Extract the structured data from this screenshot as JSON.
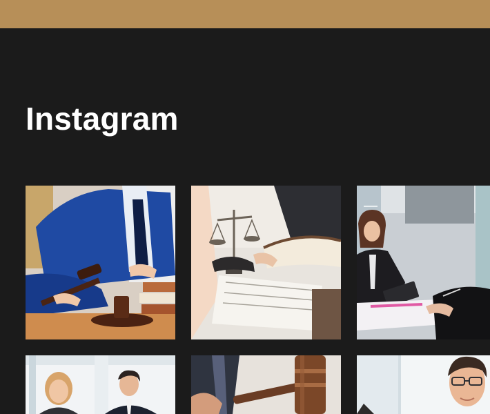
{
  "header": {
    "accent_color": "#b78f58"
  },
  "instagram": {
    "title": "Instagram",
    "photos": [
      {
        "icon": "lawyer-gavel-books-photo"
      },
      {
        "icon": "scales-of-justice-documents-photo"
      },
      {
        "icon": "business-meeting-tablet-photo"
      },
      {
        "icon": "smiling-colleagues-photo"
      },
      {
        "icon": "gavel-closeup-photo"
      },
      {
        "icon": "businessman-glasses-portrait-photo"
      }
    ]
  },
  "colors": {
    "background": "#1b1b1b",
    "title": "#ffffff"
  }
}
